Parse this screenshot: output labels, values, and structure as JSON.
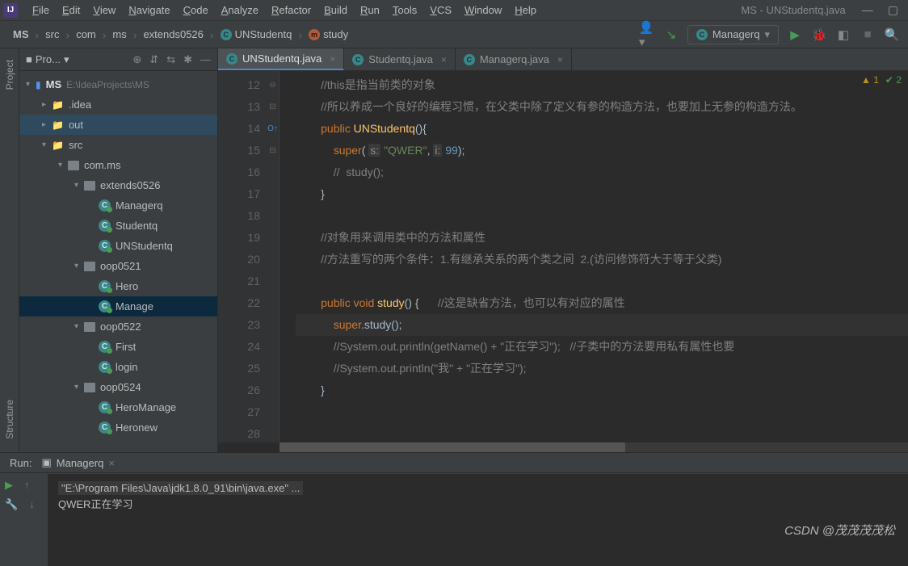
{
  "window": {
    "title": "MS - UNStudentq.java"
  },
  "menu": [
    "File",
    "Edit",
    "View",
    "Navigate",
    "Code",
    "Analyze",
    "Refactor",
    "Build",
    "Run",
    "Tools",
    "VCS",
    "Window",
    "Help"
  ],
  "breadcrumb": {
    "root": "MS",
    "items": [
      "src",
      "com",
      "ms",
      "extends0526"
    ],
    "cls": "UNStudentq",
    "method": "study"
  },
  "runConfig": {
    "label": "Managerq"
  },
  "sideTabs": {
    "project": "Project",
    "structure": "Structure"
  },
  "projectPanel": {
    "title": "Pro..."
  },
  "tree": {
    "root": {
      "name": "MS",
      "path": "E:\\IdeaProjects\\MS"
    },
    "idea": ".idea",
    "out": "out",
    "src": "src",
    "pkg_com": "com.ms",
    "pkg_ext": "extends0526",
    "cls_managerq": "Managerq",
    "cls_studentq": "Studentq",
    "cls_unstudentq": "UNStudentq",
    "pkg_oop0521": "oop0521",
    "cls_hero": "Hero",
    "cls_manage": "Manage",
    "pkg_oop0522": "oop0522",
    "cls_first": "First",
    "cls_login": "login",
    "pkg_oop0524": "oop0524",
    "cls_heromanage": "HeroManage",
    "cls_heronew": "Heronew"
  },
  "tabs": [
    {
      "label": "UNStudentq.java",
      "active": true
    },
    {
      "label": "Studentq.java",
      "active": false
    },
    {
      "label": "Managerq.java",
      "active": false
    }
  ],
  "status": {
    "warnings": "1",
    "checks": "2"
  },
  "code": {
    "lines": [
      {
        "n": 12,
        "html": "        <span class='cm'>//this是指当前类的对象</span>"
      },
      {
        "n": 13,
        "html": "        <span class='cm'>//所以养成一个良好的编程习惯，在父类中除了定义有参的构造方法，也要加上无参的构造方法。</span>"
      },
      {
        "n": 14,
        "html": "        <span class='kw'>public</span> <span class='fn'>UNStudentq</span>(){"
      },
      {
        "n": 15,
        "html": "            <span class='kw'>super</span>( <span class='param'>s:</span> <span class='str'>\"QWER\"</span>, <span class='param'>i:</span> <span class='num'>99</span>);"
      },
      {
        "n": 16,
        "html": "            <span class='cm'>//  study();</span>"
      },
      {
        "n": 17,
        "html": "        }"
      },
      {
        "n": 18,
        "html": ""
      },
      {
        "n": 19,
        "html": "        <span class='cm'>//对象用来调用类中的方法和属性</span>"
      },
      {
        "n": 20,
        "html": "        <span class='cm'>//方法重写的两个条件：1.有继承关系的两个类之间  2.(访问修饰符大于等于父类)</span>"
      },
      {
        "n": 21,
        "html": ""
      },
      {
        "n": 22,
        "html": "        <span class='kw'>public void</span> <span class='fn'>study</span>() {      <span class='cm'>//这是缺省方法，也可以有对应的属性</span>",
        "mark": "override"
      },
      {
        "n": 23,
        "html": "            <span class='kw'>super</span>.study();",
        "hl": true
      },
      {
        "n": 24,
        "html": "            <span class='cm'>//System.out.println(getName() + \"正在学习\");   //子类中的方法要用私有属性也要</span>"
      },
      {
        "n": 25,
        "html": "            <span class='cm'>//System.out.println(\"我\" + \"正在学习\");</span>"
      },
      {
        "n": 26,
        "html": "        }"
      },
      {
        "n": 27,
        "html": ""
      },
      {
        "n": 28,
        "html": ""
      }
    ]
  },
  "run": {
    "label": "Run:",
    "config": "Managerq",
    "cmd": "\"E:\\Program Files\\Java\\jdk1.8.0_91\\bin\\java.exe\" ...",
    "out1": "QWER正在学习"
  },
  "watermark": "CSDN @茂茂茂茂松"
}
